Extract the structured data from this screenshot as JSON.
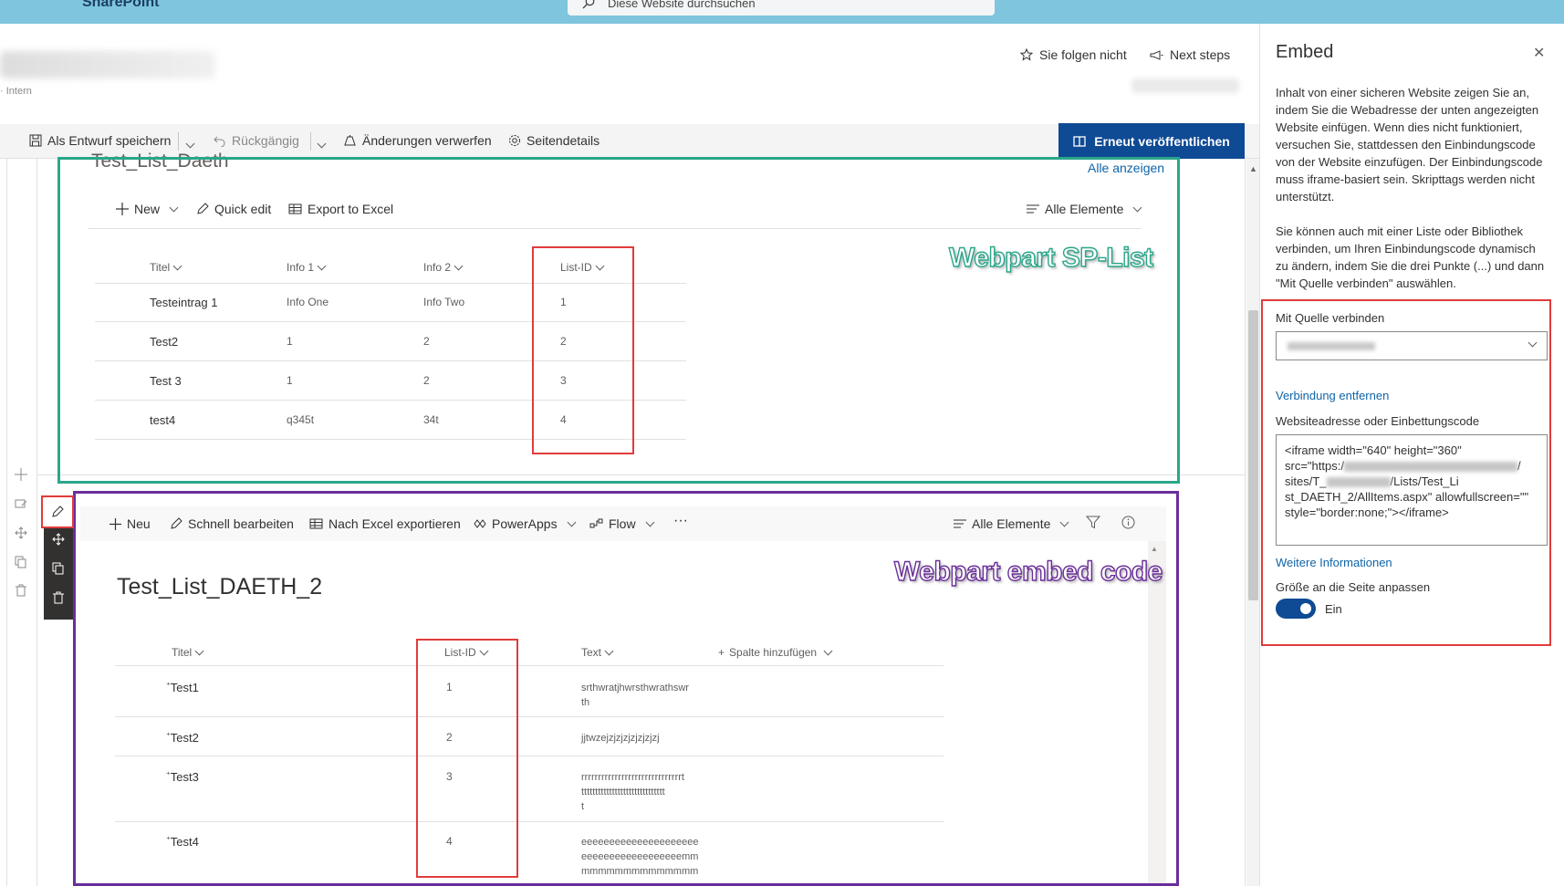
{
  "suite": {
    "brand": "SharePoint",
    "search_placeholder": "Diese Website durchsuchen"
  },
  "site_header": {
    "subtitle": "· Intern",
    "follow_label": "Sie folgen nicht",
    "next_steps_label": "Next steps"
  },
  "command_bar": {
    "save_draft": "Als Entwurf speichern",
    "undo": "Rückgängig",
    "discard": "Änderungen verwerfen",
    "page_details": "Seitendetails",
    "republish": "Erneut veröffentlichen"
  },
  "webpart_list": {
    "title": "Test_List_Daeth",
    "see_all": "Alle anzeigen",
    "cmd_new": "New",
    "cmd_quick_edit": "Quick edit",
    "cmd_export": "Export to Excel",
    "view": "Alle Elemente",
    "columns": [
      "Titel",
      "Info 1",
      "Info 2",
      "List-ID"
    ],
    "rows": [
      [
        "Testeintrag 1",
        "Info One",
        "Info Two",
        "1"
      ],
      [
        "Test2",
        "1",
        "2",
        "2"
      ],
      [
        "Test 3",
        "1",
        "2",
        "3"
      ],
      [
        "test4",
        "q345t",
        "34t",
        "4"
      ]
    ],
    "callout": "Webpart SP-List"
  },
  "webpart_embed": {
    "cmd_new": "Neu",
    "cmd_quick_edit": "Schnell bearbeiten",
    "cmd_export": "Nach Excel exportieren",
    "cmd_powerapps": "PowerApps",
    "cmd_flow": "Flow",
    "cmd_more": "···",
    "view": "Alle Elemente",
    "title": "Test_List_DAETH_2",
    "columns": [
      "Titel",
      "List-ID",
      "Text"
    ],
    "add_column": "Spalte hinzufügen",
    "rows": [
      {
        "title": "Test1",
        "id": "1",
        "text": [
          "srthwratjhwrsthwrathswr",
          "th"
        ]
      },
      {
        "title": "Test2",
        "id": "2",
        "text": [
          "jjtwzejzjzjzjzjzjzjzj"
        ]
      },
      {
        "title": "Test3",
        "id": "3",
        "text": [
          "rrrrrrrrrrrrrrrrrrrrrrrrrrrrrrt",
          "tttttttttttttttttttttttttttttt",
          "t"
        ]
      },
      {
        "title": "Test4",
        "id": "4",
        "text": [
          "eeeeeeeeeeeeeeeeeeeee",
          "eeeeeeeeeeeeeeeeeemm",
          "mmmmmmmmmmmmmm"
        ]
      }
    ],
    "callout": "Webpart embed code"
  },
  "embed_panel": {
    "title": "Embed",
    "desc1": "Inhalt von einer sicheren Website zeigen Sie an, indem Sie die Webadresse der unten angezeigten Website einfügen. Wenn dies nicht funktioniert, versuchen Sie, stattdessen den Einbindungscode von der Website einzufügen. Der Einbindungscode muss iframe-basiert sein. Skripttags werden nicht unterstützt.",
    "desc2": "Sie können auch mit einer Liste oder Bibliothek verbinden, um Ihren Einbindungscode dynamisch zu ändern, indem Sie die drei Punkte (...) und dann \"Mit Quelle verbinden\" auswählen.",
    "connect_label": "Mit Quelle verbinden",
    "remove_connection": "Verbindung entfernen",
    "address_label": "Websiteadresse oder Einbettungscode",
    "code_line1": "<iframe width=\"640\" height=\"360\"",
    "code_line2a": "src=\"https:/",
    "code_line2b": "/",
    "code_line3a": "sites/T_",
    "code_line3b": "/Lists/Test_Li",
    "code_line4": "st_DAETH_2/AllItems.aspx\" allowfullscreen=\"\"",
    "code_line5": "style=\"border:none;\"></iframe>",
    "more_info": "Weitere Informationen",
    "fit_label": "Größe an die Seite anpassen",
    "toggle_state": "Ein"
  },
  "colors": {
    "suitebar": "#7fc5de",
    "publish": "#0f4a94",
    "green": "#2aa68a",
    "purple": "#6a2e9a",
    "red": "#e23b3b",
    "link": "#0f64a8"
  }
}
